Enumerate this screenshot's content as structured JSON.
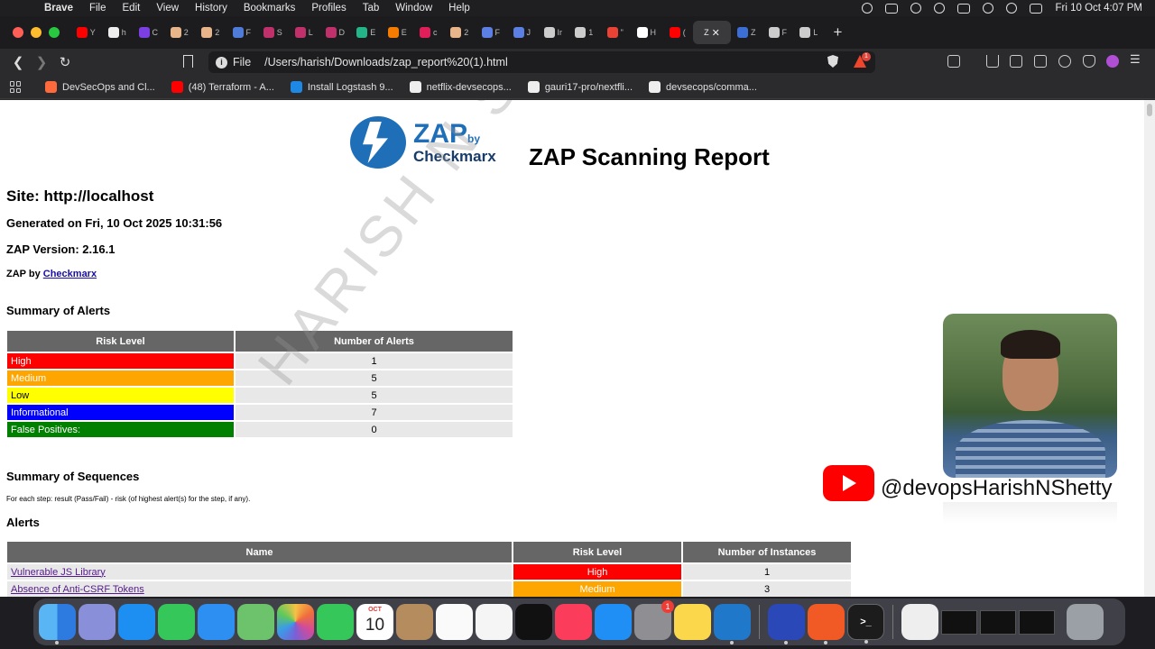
{
  "menubar": {
    "app_name": "Brave",
    "items": [
      "File",
      "Edit",
      "View",
      "History",
      "Bookmarks",
      "Profiles",
      "Tab",
      "Window",
      "Help"
    ],
    "clock": "Fri 10 Oct  4:07 PM"
  },
  "tabs": [
    {
      "letter": "Y",
      "color": "#ff0000"
    },
    {
      "letter": "h",
      "color": "#eeeeee"
    },
    {
      "letter": "C",
      "color": "#7b3fe4"
    },
    {
      "letter": "2",
      "color": "#e8b48a"
    },
    {
      "letter": "2",
      "color": "#e8b48a"
    },
    {
      "letter": "F",
      "color": "#4f7cd8"
    },
    {
      "letter": "S",
      "color": "#c0306b"
    },
    {
      "letter": "L",
      "color": "#c0306b"
    },
    {
      "letter": "D",
      "color": "#c0306b"
    },
    {
      "letter": "E",
      "color": "#23b487"
    },
    {
      "letter": "E",
      "color": "#f57c00"
    },
    {
      "letter": "c",
      "color": "#e01e5a"
    },
    {
      "letter": "2",
      "color": "#e8b48a"
    },
    {
      "letter": "F",
      "color": "#5b7fe3"
    },
    {
      "letter": "J",
      "color": "#5b7fe3"
    },
    {
      "letter": "Ir",
      "color": "#cccccc"
    },
    {
      "letter": "1",
      "color": "#cccccc"
    },
    {
      "letter": "\"",
      "color": "#ea4335"
    },
    {
      "letter": "H",
      "color": "#ffffff"
    },
    {
      "letter": "(",
      "color": "#ff0000"
    },
    {
      "letter": "Z",
      "color": "#3b6fd6"
    },
    {
      "letter": "F",
      "color": "#cccccc"
    },
    {
      "letter": "L",
      "color": "#cccccc"
    }
  ],
  "active_tab": {
    "letter": "Z",
    "close": "✕"
  },
  "new_tab": "+",
  "toolbar": {
    "scheme": "File",
    "url": "/Users/harish/Downloads/zap_report%20(1).html",
    "rewards_badge": "1"
  },
  "bookmarks": [
    {
      "label": "DevSecOps and Cl...",
      "color": "#ff6a3d"
    },
    {
      "label": "(48) Terraform - A...",
      "color": "#ff0000"
    },
    {
      "label": "Install Logstash 9...",
      "color": "#1e88e5"
    },
    {
      "label": "netflix-devsecops...",
      "color": "#eeeeee"
    },
    {
      "label": "gauri17-pro/nextfli...",
      "color": "#eeeeee"
    },
    {
      "label": "devsecops/comma...",
      "color": "#eeeeee"
    }
  ],
  "report": {
    "logo_zap": "ZAP",
    "logo_by": "by",
    "logo_checkmarx": "Checkmarx",
    "title": "ZAP Scanning Report",
    "site": "Site: http://localhost",
    "generated": "Generated on Fri, 10 Oct 2025 10:31:56",
    "version": "ZAP Version: 2.16.1",
    "zap_by_prefix": "ZAP by",
    "zap_by_link": "Checkmarx",
    "summary_heading": "Summary of Alerts",
    "summary_headers": [
      "Risk Level",
      "Number of Alerts"
    ],
    "summary_rows": [
      {
        "level": "High",
        "count": "1",
        "color": "#ff0000",
        "text": "#ffffff"
      },
      {
        "level": "Medium",
        "count": "5",
        "color": "#ffa500",
        "text": "#ffffff"
      },
      {
        "level": "Low",
        "count": "5",
        "color": "#ffff00",
        "text": "#000000"
      },
      {
        "level": "Informational",
        "count": "7",
        "color": "#0000ff",
        "text": "#ffffff"
      },
      {
        "level": "False Positives:",
        "count": "0",
        "color": "#008000",
        "text": "#ffffff"
      }
    ],
    "sequences_heading": "Summary of Sequences",
    "sequences_note": "For each step: result (Pass/Fail) - risk (of highest alert(s) for the step, if any).",
    "alerts_heading": "Alerts",
    "alerts_headers": [
      "Name",
      "Risk Level",
      "Number of Instances"
    ],
    "alerts_rows": [
      {
        "name": "Vulnerable JS Library",
        "risk": "High",
        "instances": "1",
        "color": "#ff0000"
      },
      {
        "name": "Absence of Anti-CSRF Tokens",
        "risk": "Medium",
        "instances": "3",
        "color": "#ffa500"
      }
    ]
  },
  "overlay": {
    "watermark": "HARISH N SHETTY",
    "youtube_handle": "@devopsHarishNShetty"
  },
  "dock": {
    "calendar_month": "OCT",
    "calendar_day": "10",
    "settings_badge": "1",
    "terminal_label": ">_"
  }
}
